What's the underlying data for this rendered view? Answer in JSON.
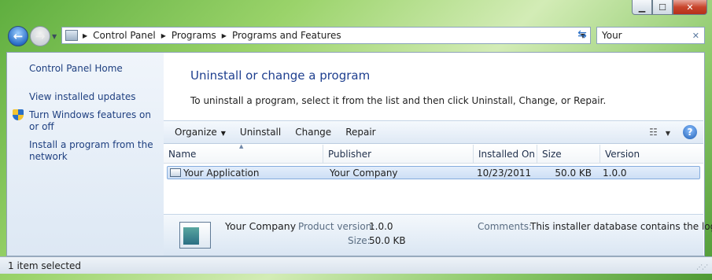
{
  "window": {
    "caption": {
      "minimize_icon": "minimize-icon",
      "maximize_icon": "maximize-icon",
      "close_icon": "close-icon"
    }
  },
  "nav": {
    "breadcrumbs": [
      "Control Panel",
      "Programs",
      "Programs and Features"
    ],
    "search_value": "Your"
  },
  "sidebar": {
    "items": [
      {
        "label": "Control Panel Home"
      },
      {
        "label": "View installed updates"
      },
      {
        "label": "Turn Windows features on or off"
      },
      {
        "label": "Install a program from the network"
      }
    ]
  },
  "main": {
    "title": "Uninstall or change a program",
    "subtitle": "To uninstall a program, select it from the list and then click Uninstall, Change, or Repair."
  },
  "toolbar": {
    "organize": "Organize",
    "uninstall": "Uninstall",
    "change": "Change",
    "repair": "Repair"
  },
  "table": {
    "columns": [
      "Name",
      "Publisher",
      "Installed On",
      "Size",
      "Version"
    ],
    "rows": [
      {
        "name": "Your Application",
        "publisher": "Your Company",
        "installed_on": "10/23/2011",
        "size": "50.0 KB",
        "version": "1.0.0"
      }
    ]
  },
  "details": {
    "publisher": "Your Company",
    "product_version_label": "Product version:",
    "product_version": "1.0.0",
    "size_label": "Size:",
    "size": "50.0 KB",
    "comments_label": "Comments:",
    "comments": "This installer database contains the log..."
  },
  "status": {
    "text": "1 item selected"
  },
  "colors": {
    "accent": "#1e3f8f",
    "link": "#1e3f80",
    "selection": "#cddff5",
    "frame": "#7cc151"
  }
}
